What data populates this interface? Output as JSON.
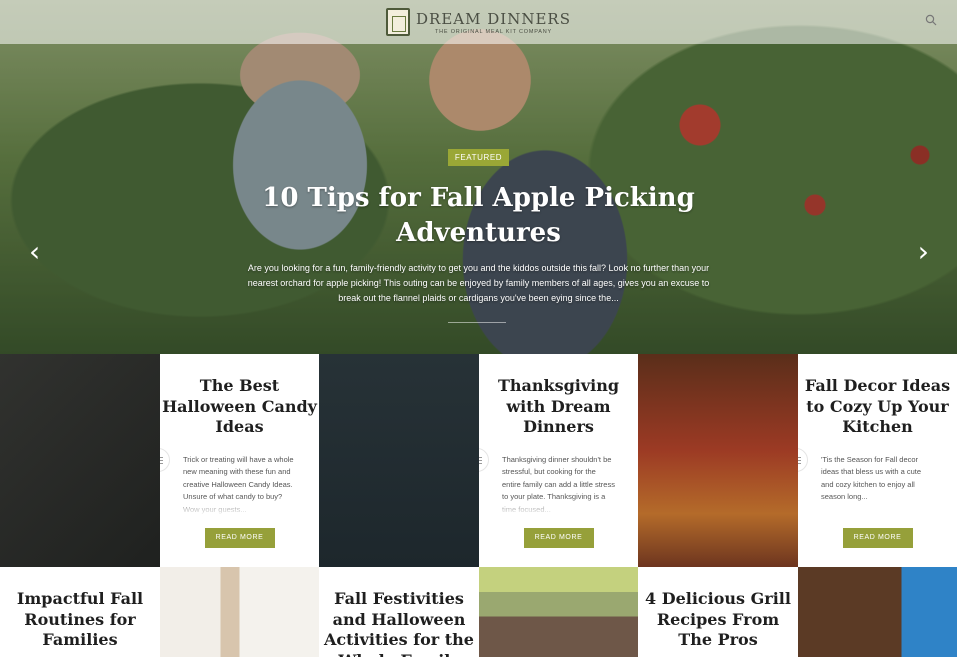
{
  "header": {
    "brand_name": "DREAM DINNERS",
    "tagline": "THE ORIGINAL MEAL KIT COMPANY",
    "search_icon": "search-icon"
  },
  "hero": {
    "badge": "FEATURED",
    "title": "10 Tips for Fall Apple Picking Adventures",
    "excerpt": "Are you looking for a fun, family-friendly activity to get you and the kiddos outside this fall? Look no further than your nearest orchard for apple picking! This outing can be enjoyed by family members of all ages, gives you an excuse to break out the flannel plaids or cardigans you've been eying since the...",
    "prev_icon": "chevron-left-icon",
    "next_icon": "chevron-right-icon"
  },
  "cards": [
    {
      "title": "The Best Halloween Candy Ideas",
      "excerpt": "Trick or treating will have a whole new meaning with these fun and creative Halloween Candy Ideas. Unsure of what candy to buy? Wow your guests...",
      "button": "READ MORE"
    },
    {
      "title": "Thanksgiving with Dream Dinners",
      "excerpt": "Thanksgiving dinner shouldn't be stressful, but cooking for the entire family can add a little stress to your plate. Thanksgiving is a time focused...",
      "button": "READ MORE"
    },
    {
      "title": "Fall Decor Ideas to Cozy Up Your Kitchen",
      "excerpt": "'Tis the Season for Fall decor ideas that bless us with a cute and cozy kitchen to enjoy all season long...",
      "button": "READ MORE"
    }
  ],
  "bottom_titles": [
    "Impactful Fall Routines for Families",
    "Fall Festivities and Halloween Activities for the Whole Family",
    "4 Delicious Grill Recipes From The Pros"
  ],
  "colors": {
    "accent": "#96a03a",
    "card_bg": "#ffffff",
    "title_text": "#1f1f1f"
  }
}
